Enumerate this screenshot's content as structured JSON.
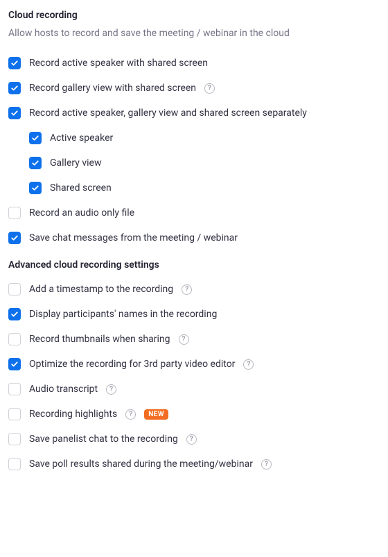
{
  "cloud": {
    "title": "Cloud recording",
    "subtitle": "Allow hosts to record and save the meeting / webinar in the cloud",
    "options": {
      "active_speaker_shared": {
        "label": "Record active speaker with shared screen",
        "checked": true
      },
      "gallery_shared": {
        "label": "Record gallery view with shared screen",
        "checked": true,
        "help": true
      },
      "separate": {
        "label": "Record active speaker, gallery view and shared screen separately",
        "checked": true
      },
      "sep_active": {
        "label": "Active speaker",
        "checked": true
      },
      "sep_gallery": {
        "label": "Gallery view",
        "checked": true
      },
      "sep_shared": {
        "label": "Shared screen",
        "checked": true
      },
      "audio_only": {
        "label": "Record an audio only file",
        "checked": false
      },
      "save_chat": {
        "label": "Save chat messages from the meeting / webinar",
        "checked": true
      }
    }
  },
  "advanced": {
    "title": "Advanced cloud recording settings",
    "options": {
      "timestamp": {
        "label": "Add a timestamp to the recording",
        "checked": false,
        "help": true
      },
      "names": {
        "label": "Display participants' names in the recording",
        "checked": true
      },
      "thumbnails": {
        "label": "Record thumbnails when sharing",
        "checked": false,
        "help": true
      },
      "optimize": {
        "label": "Optimize the recording for 3rd party video editor",
        "checked": true,
        "help": true
      },
      "transcript": {
        "label": "Audio transcript",
        "checked": false,
        "help": true
      },
      "highlights": {
        "label": "Recording highlights",
        "checked": false,
        "help": true,
        "badge": "NEW"
      },
      "panelist": {
        "label": "Save panelist chat to the recording",
        "checked": false,
        "help": true
      },
      "poll": {
        "label": "Save poll results shared during the meeting/webinar",
        "checked": false,
        "help": true
      }
    }
  },
  "help_glyph": "?"
}
